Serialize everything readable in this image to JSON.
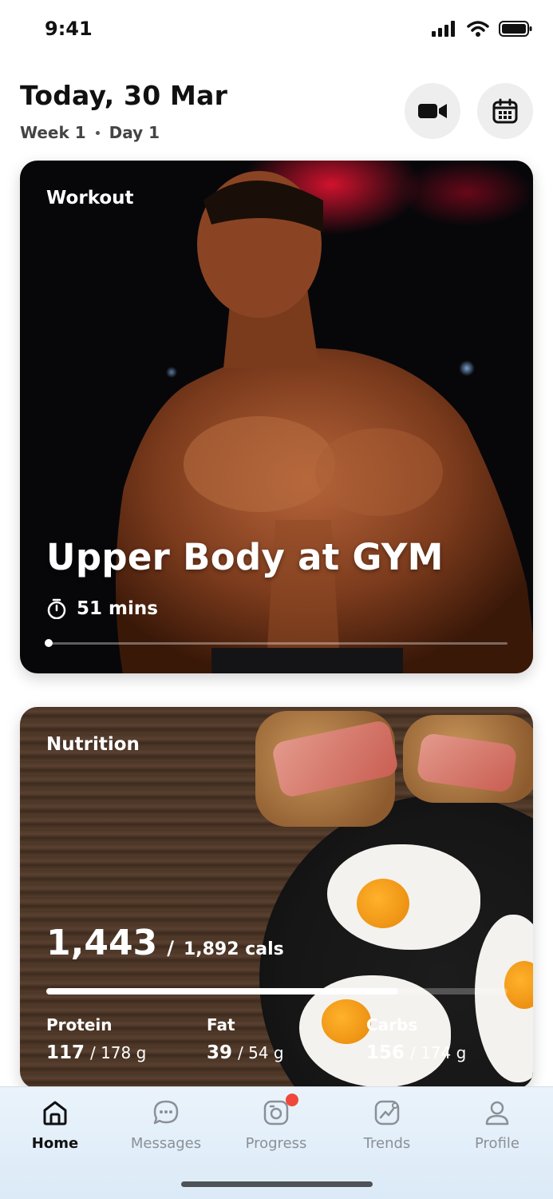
{
  "status_bar": {
    "time": "9:41"
  },
  "header": {
    "title": "Today, 30 Mar",
    "week": "Week 1",
    "day": "Day 1",
    "actions": [
      {
        "icon": "video-camera-icon"
      },
      {
        "icon": "calendar-icon"
      }
    ]
  },
  "workout": {
    "label": "Workout",
    "title": "Upper Body at GYM",
    "duration": "51 mins",
    "progress_fraction": 0.0
  },
  "nutrition": {
    "label": "Nutrition",
    "calories": "1,443",
    "separator": "/",
    "calories_target": "1,892 cals",
    "calories_fraction": 0.763,
    "macros": [
      {
        "name": "Protein",
        "value": "117",
        "target": "/ 178 g"
      },
      {
        "name": "Fat",
        "value": "39",
        "target": "/ 54 g"
      },
      {
        "name": "Carbs",
        "value": "156",
        "target": "/ 174 g"
      }
    ]
  },
  "tabbar": {
    "tabs": [
      {
        "label": "Home",
        "icon": "home-icon",
        "active": true
      },
      {
        "label": "Messages",
        "icon": "chat-bubble-icon",
        "active": false
      },
      {
        "label": "Progress",
        "icon": "camera-icon",
        "active": false,
        "badge": true
      },
      {
        "label": "Trends",
        "icon": "trend-chart-icon",
        "active": false
      },
      {
        "label": "Profile",
        "icon": "user-icon",
        "active": false
      }
    ]
  },
  "colors": {
    "badge": "#f0473c",
    "inactive_tab": "#8a9096",
    "active_tab": "#111111"
  }
}
